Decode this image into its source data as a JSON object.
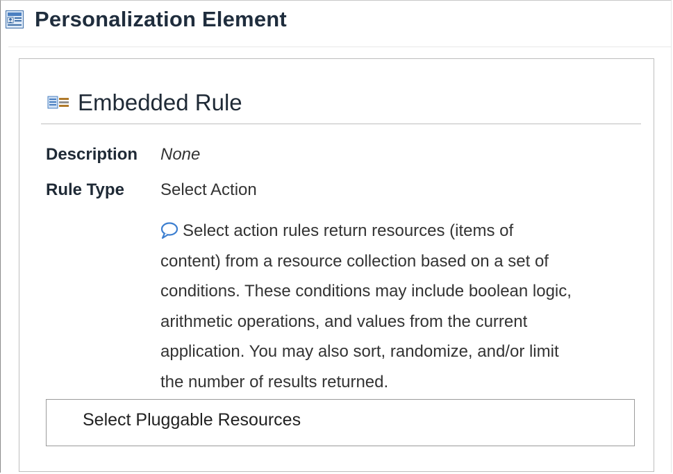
{
  "page": {
    "title": "Personalization Element",
    "icon": "personalization-element-icon"
  },
  "rule": {
    "title": "Embedded Rule",
    "icon": "embedded-rule-icon",
    "description_label": "Description",
    "description_value": "None",
    "type_label": "Rule Type",
    "type_value": "Select Action",
    "help_icon": "speech-bubble-icon",
    "help_lines": [
      "Select action rules return resources (items of",
      "content) from a resource collection based on a set of",
      "conditions. These conditions may include boolean logic,",
      "arithmetic operations, and values from the current",
      "application. You may also sort, randomize, and/or limit",
      "the number of results returned."
    ]
  },
  "pluggable": {
    "label": "Select Pluggable Resources"
  },
  "colors": {
    "title_text": "#1f2d3d",
    "panel_border": "#bdbdbd",
    "icon_blue": "#4a7fc1"
  }
}
